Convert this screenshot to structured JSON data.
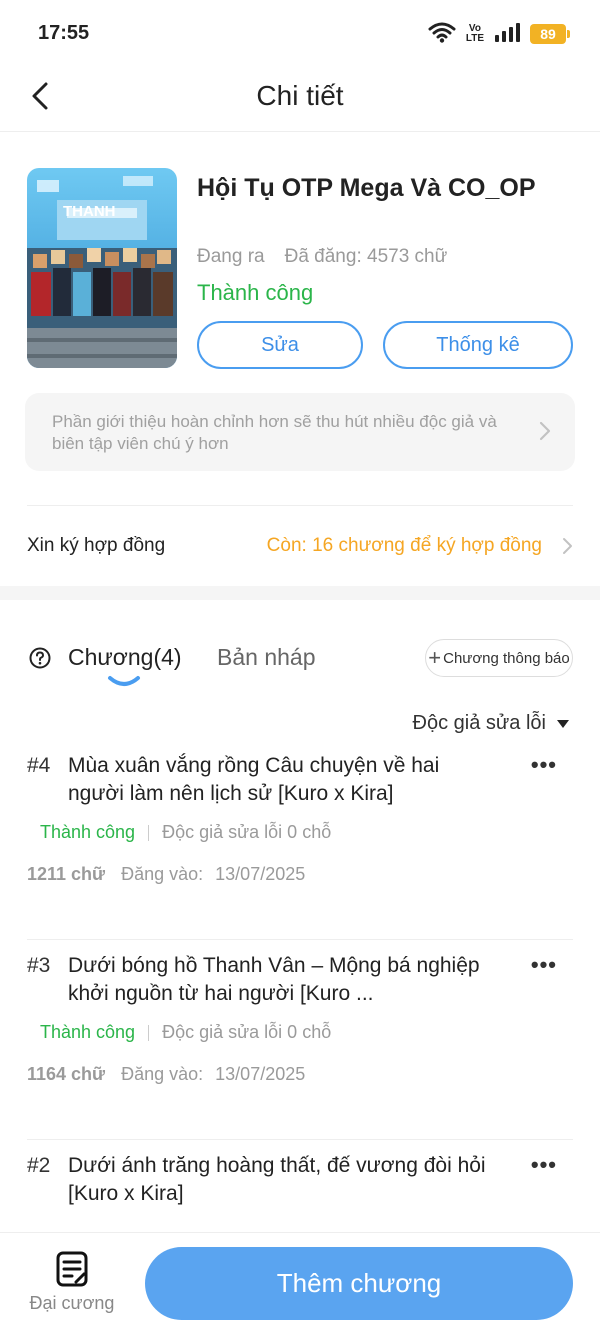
{
  "status_bar": {
    "time": "17:55",
    "network_line1": "Vo",
    "network_line2": "LTE",
    "battery": "89",
    "icons": [
      "wifi-icon",
      "signal-icon",
      "battery-icon"
    ]
  },
  "nav": {
    "title": "Chi tiết",
    "back_icon": "chevron-left-icon"
  },
  "book": {
    "title": "Hội Tụ OTP Mega Và CO_OP",
    "state": "Đang ra",
    "word_count": "Đã đăng: 4573 chữ",
    "status": "Thành công",
    "edit_label": "Sửa",
    "stats_label": "Thống kê",
    "intro_hint": "Phần giới thiệu hoàn chỉnh hơn sẽ thu hút nhiều độc giả và biên tập viên chú ý hơn",
    "cover_banner_text": "THANH"
  },
  "contract": {
    "label": "Xin ký hợp đồng",
    "value": "Còn: 16 chương để ký hợp đồng"
  },
  "tabs": {
    "chapters": "Chương(4)",
    "drafts": "Bản nháp",
    "notice_button": "Chương thông báo"
  },
  "filter": {
    "label": "Độc giả sửa lỗi"
  },
  "chapters": [
    {
      "number": "#4",
      "title": "Mùa xuân vắng rồng Câu chuyện về hai người làm nên lịch sử [Kuro x Kira]",
      "status": "Thành công",
      "errors": "Độc giả sửa lỗi 0 chỗ",
      "words": "1211 chữ",
      "date_label": "Đăng vào:",
      "date": "13/07/2025"
    },
    {
      "number": "#3",
      "title": "Dưới bóng hồ Thanh Vân – Mộng bá nghiệp khởi nguồn từ hai người [Kuro ...",
      "status": "Thành công",
      "errors": "Độc giả sửa lỗi 0 chỗ",
      "words": "1164 chữ",
      "date_label": "Đăng vào:",
      "date": "13/07/2025"
    },
    {
      "number": "#2",
      "title": "Dưới ánh trăng hoàng thất, đế vương đòi hỏi [Kuro x Kira]"
    }
  ],
  "more_label": "•••",
  "bottom": {
    "outline_label": "Đại cương",
    "add_chapter_label": "Thêm chương"
  },
  "colors": {
    "accent_blue": "#4a9df0",
    "button_blue": "#5aa4f0",
    "success_green": "#2bb54a",
    "warning_orange": "#f5a623",
    "battery_yellow": "#f2b224"
  }
}
